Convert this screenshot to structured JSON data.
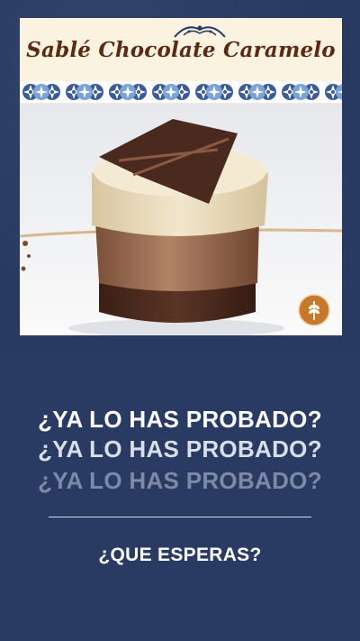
{
  "product": {
    "title": "Sablé Chocolate Caramelo"
  },
  "headlines": [
    "¿YA LO HAS PROBADO?",
    "¿YA LO HAS PROBADO?",
    "¿YA LO HAS PROBADO?"
  ],
  "cta": "¿QUE ESPERAS?",
  "colors": {
    "background": "#2a3b63",
    "banner": "#fbf2e0",
    "title_text": "#5a2a14",
    "badge": "#c8782a"
  },
  "icons": {
    "badge": "wheat-icon",
    "ornament": "flourish-ornament-icon"
  }
}
